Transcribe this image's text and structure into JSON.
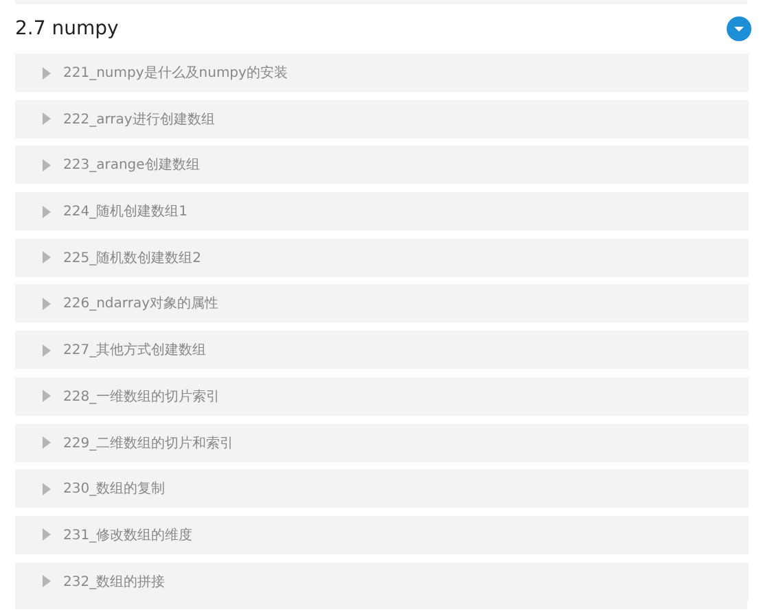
{
  "section": {
    "title": "2.7 numpy",
    "expanded": true,
    "lessons": [
      {
        "label": "221_numpy是什么及numpy的安装"
      },
      {
        "label": "222_array进行创建数组"
      },
      {
        "label": "223_arange创建数组"
      },
      {
        "label": "224_随机创建数组1"
      },
      {
        "label": "225_随机数创建数组2"
      },
      {
        "label": "226_ndarray对象的属性"
      },
      {
        "label": "227_其他方式创建数组"
      },
      {
        "label": "228_一维数组的切片索引"
      },
      {
        "label": "229_二维数组的切片和索引"
      },
      {
        "label": "230_数组的复制"
      },
      {
        "label": "231_修改数组的维度"
      },
      {
        "label": "232_数组的拼接"
      }
    ]
  }
}
